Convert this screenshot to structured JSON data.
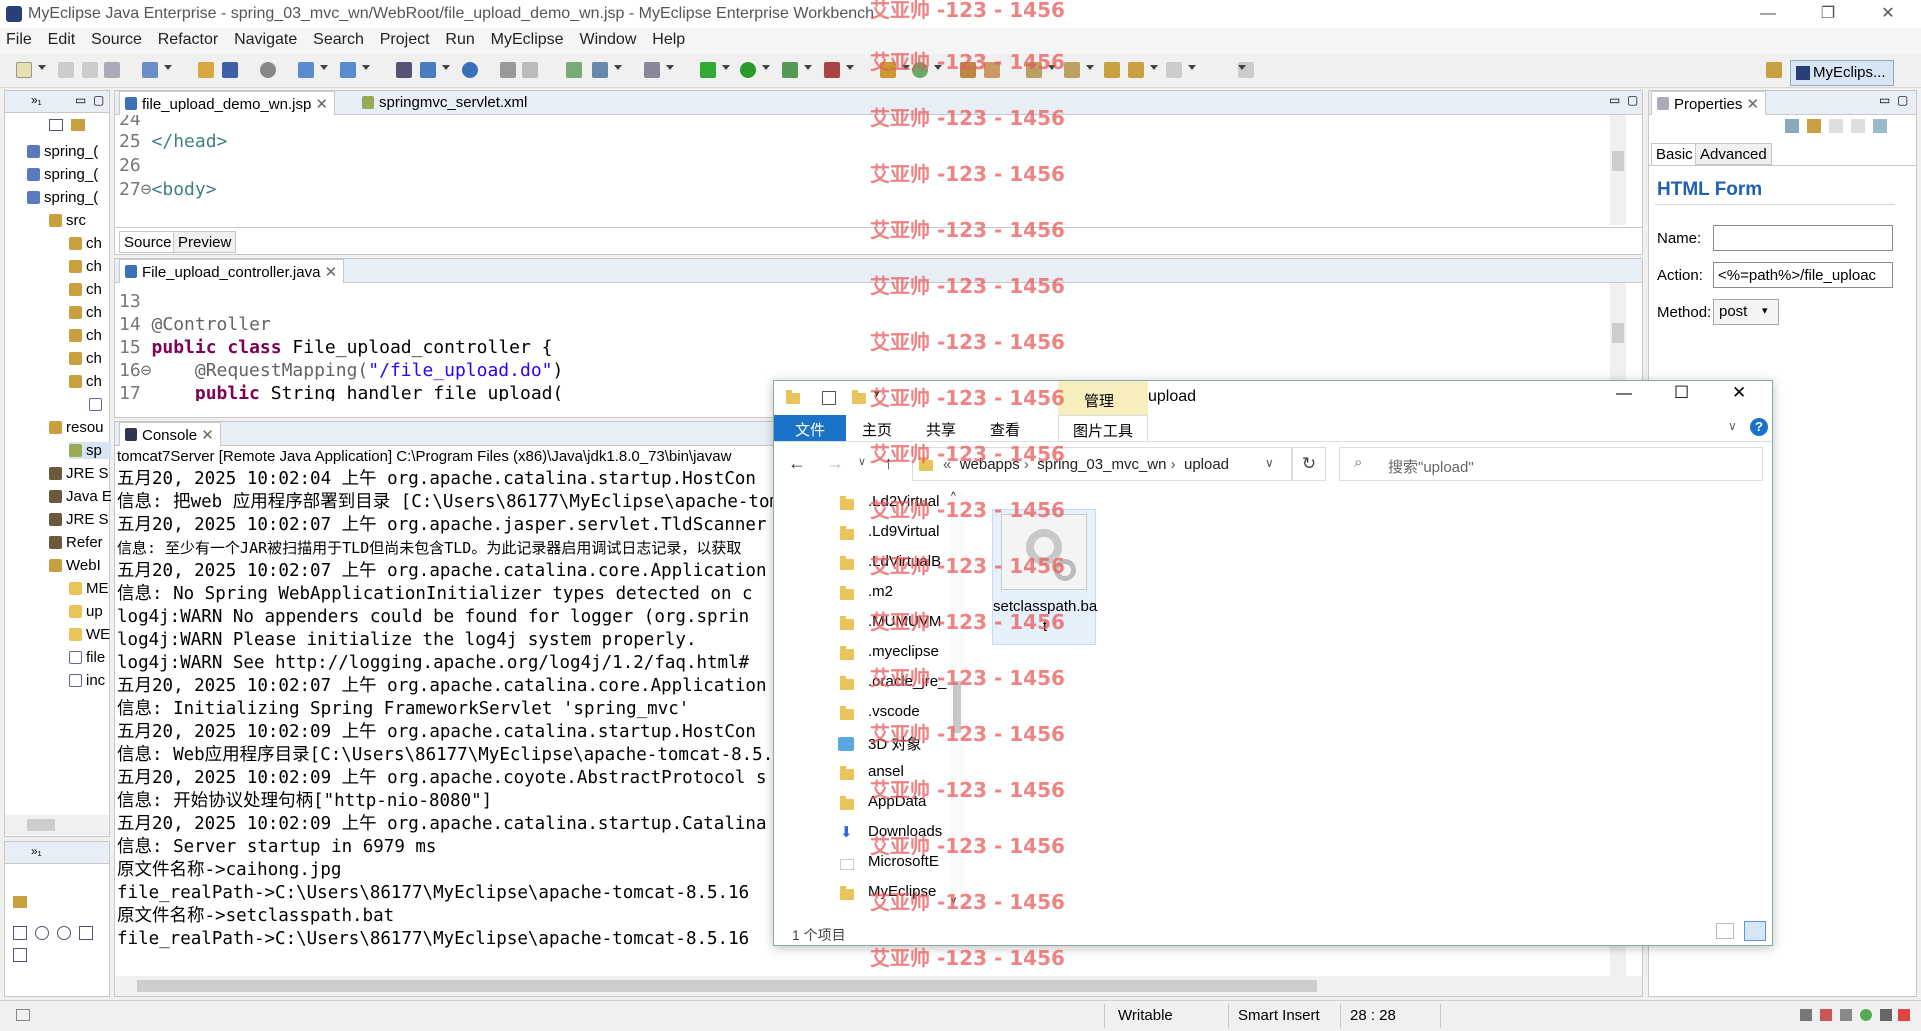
{
  "window": {
    "title": "MyEclipse Java Enterprise - spring_03_mvc_wn/WebRoot/file_upload_demo_wn.jsp - MyEclipse Enterprise Workbench"
  },
  "menu": [
    "File",
    "Edit",
    "Source",
    "Refactor",
    "Navigate",
    "Search",
    "Project",
    "Run",
    "MyEclipse",
    "Window",
    "Help"
  ],
  "perspective": {
    "label": "MyEclips..."
  },
  "tree": {
    "items": [
      "spring_(",
      "spring_(",
      "spring_(",
      "src",
      "ch",
      "ch",
      "ch",
      "ch",
      "ch",
      "ch",
      "ch",
      "resou",
      "sp",
      "JRE S",
      "Java E",
      "JRE S",
      "Refer",
      "WebI",
      "ME",
      "up",
      "WE",
      "file",
      "inc"
    ]
  },
  "editor1": {
    "tabs": [
      "file_upload_demo_wn.jsp",
      "springmvc_servlet.xml"
    ],
    "lines": [
      {
        "n": "24",
        "t": ""
      },
      {
        "n": "25",
        "t": "</head>"
      },
      {
        "n": "26",
        "t": ""
      },
      {
        "n": "27⊖",
        "t": "<body>"
      }
    ],
    "bottom_tabs": [
      "Source",
      "Preview"
    ]
  },
  "editor2": {
    "tab": "File_upload_controller.java",
    "lines": [
      {
        "n": "13",
        "t": ""
      },
      {
        "n": "14",
        "t": "@Controller"
      },
      {
        "n": "15",
        "kw": "public class",
        "t": " File_upload_controller {"
      },
      {
        "n": "16⊖",
        "ann": "@RequestMapping(",
        "str": "\"/file_upload.do\"",
        "t": ")"
      },
      {
        "n": "17",
        "kw": "public",
        "t": " String handler_file_upload("
      }
    ]
  },
  "console": {
    "tab": "Console",
    "header": "tomcat7Server [Remote Java Application] C:\\Program Files (x86)\\Java\\jdk1.8.0_73\\bin\\javaw",
    "lines": [
      "五月20, 2025 10:02:04 上午 org.apache.catalina.startup.HostCon",
      "信息: 把web 应用程序部署到目录 [C:\\Users\\86177\\MyEclipse\\apache-tomc",
      "五月20, 2025 10:02:07 上午 org.apache.jasper.servlet.TldScanner",
      "信息: 至少有一个JAR被扫描用于TLD但尚未包含TLD。为此记录器启用调试日志记录，以获取",
      "五月20, 2025 10:02:07 上午 org.apache.catalina.core.Application",
      "信息: No Spring WebApplicationInitializer types detected on c",
      "log4j:WARN No appenders could be found for logger (org.sprin",
      "log4j:WARN Please initialize the log4j system properly.",
      "log4j:WARN See http://logging.apache.org/log4j/1.2/faq.html#",
      "五月20, 2025 10:02:07 上午 org.apache.catalina.core.Application",
      "信息: Initializing Spring FrameworkServlet 'spring_mvc'",
      "五月20, 2025 10:02:09 上午 org.apache.catalina.startup.HostCon",
      "信息: Web应用程序目录[C:\\Users\\86177\\MyEclipse\\apache-tomcat-8.5.",
      "五月20, 2025 10:02:09 上午 org.apache.coyote.AbstractProtocol s",
      "信息: 开始协议处理句柄[\"http-nio-8080\"]",
      "五月20, 2025 10:02:09 上午 org.apache.catalina.startup.Catalina",
      "信息: Server startup in 6979 ms",
      "原文件名称->caihong.jpg",
      "file_realPath->C:\\Users\\86177\\MyEclipse\\apache-tomcat-8.5.16",
      "原文件名称->setclasspath.bat",
      "file_realPath->C:\\Users\\86177\\MyEclipse\\apache-tomcat-8.5.16"
    ]
  },
  "properties": {
    "tab": "Properties",
    "subtabs": [
      "Basic",
      "Advanced"
    ],
    "heading": "HTML Form",
    "name_label": "Name:",
    "name_value": "",
    "action_label": "Action:",
    "action_value": "<%=path%>/file_uploac",
    "method_label": "Method:",
    "method_value": "post"
  },
  "explorer": {
    "title": "upload",
    "context_tab": "管理",
    "ribbon": [
      "文件",
      "主页",
      "共享",
      "查看",
      "图片工具"
    ],
    "breadcrumb": [
      "«",
      "webapps",
      "spring_03_mvc_wn",
      "upload"
    ],
    "search_placeholder": "搜索\"upload\"",
    "nav": [
      ".Ld2Virtual",
      ".Ld9Virtual",
      ".LdVirtualB",
      ".m2",
      ".MUMUVM",
      ".myeclipse",
      ".oracle_jre_",
      ".vscode",
      "3D 对象",
      "ansel",
      "AppData",
      "Downloads",
      "MicrosoftE",
      "MyEclipse"
    ],
    "file": {
      "name_line1": "setclasspath.ba",
      "name_line2": "t"
    },
    "status": "1 个项目"
  },
  "status": {
    "writable": "Writable",
    "insert": "Smart Insert",
    "position": "28 : 28"
  },
  "watermark": "艾亚帅 -123 - 1456",
  "colors": {
    "keyword": "#7f0055",
    "string": "#2a00ff",
    "tag": "#3f7f7f",
    "watermark": "#e85a5a",
    "explorer_accent": "#1a73c8",
    "heading": "#2060b0"
  }
}
